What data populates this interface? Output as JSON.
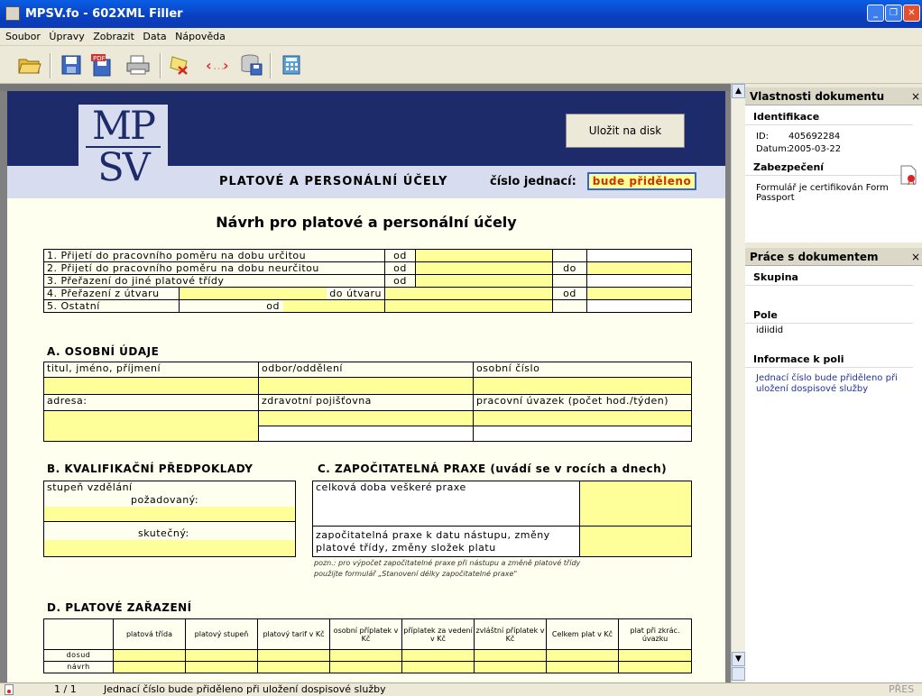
{
  "window": {
    "title": "MPSV.fo - 602XML Filler"
  },
  "menu": [
    "Soubor",
    "Úpravy",
    "Zobrazit",
    "Data",
    "Nápověda"
  ],
  "toolbar": {
    "icons": [
      "open-icon",
      "save-icon",
      "export-pdf-icon",
      "print-icon",
      "clear-form-icon",
      "xml-icon",
      "database-save-icon",
      "calculator-icon"
    ],
    "pdf_label": "PDF"
  },
  "form": {
    "logo_line1": "MP",
    "logo_line2": "SV",
    "save_button": "Uložit na disk",
    "banner_title": "PLATOVÉ A PERSONÁLNÍ ÚČELY",
    "cislo_label": "číslo jednací:",
    "cislo_value": "bude přiděleno",
    "title": "Návrh pro platové a personální účely",
    "rows": [
      {
        "label": "1. Přijetí do pracovního poměru na dobu určitou",
        "od": "od"
      },
      {
        "label": "2. Přijetí do pracovního poměru na dobu neurčitou",
        "od": "od",
        "do": "do"
      },
      {
        "label": "3. Přeřazení do jiné platové třídy",
        "od": "od"
      },
      {
        "label": "4. Přeřazení z útvaru",
        "do_utvaru": "do útvaru",
        "od": "od"
      },
      {
        "label": "5. Ostatní",
        "od": "od"
      }
    ],
    "secA": {
      "title": "A. OSOBNÍ ÚDAJE",
      "titul": "titul, jméno, příjmení",
      "odbor": "odbor/oddělení",
      "oscislo": "osobní číslo",
      "adresa": "adresa:",
      "pojistovna": "zdravotní pojišťovna",
      "uvazek": "pracovní úvazek (počet hod./týden)"
    },
    "secB": {
      "title": "B. KVALIFIKAČNÍ PŘEDPOKLADY",
      "stupen": "stupeň vzdělání",
      "pozadovany": "požadovaný:",
      "skutecny": "skutečný:"
    },
    "secC": {
      "title": "C. ZAPOČITATELNÁ PRAXE (uvádí se v rocích a dnech)",
      "celkova": "celková doba veškeré praxe",
      "zapocitatelna_1": "započitatelná praxe k datu nástupu, změny",
      "zapocitatelna_2": "platové třídy, změny složek platu",
      "pozn_1": "pozn.: pro výpočet započitatelné praxe při nástupu a změně platové třídy",
      "pozn_2": "použijte formulář „Stanovení délky započitatelné praxe\""
    },
    "secD": {
      "title": "D. PLATOVÉ ZAŘAZENÍ",
      "headers": [
        "platová třída",
        "platový stupeň",
        "platový tarif v Kč",
        "osobní příplatek v Kč",
        "příplatek za vedení v Kč",
        "zvláštní příplatek v Kč",
        "Celkem plat v Kč",
        "plat při zkrác. úvazku"
      ],
      "rows": [
        "dosud",
        "návrh"
      ]
    }
  },
  "panel": {
    "vlastnosti": "Vlastnosti dokumentu",
    "identifikace": "Identifikace",
    "id_label": "ID:",
    "id_value": "405692284",
    "datum_label": "Datum:",
    "datum_value": "2005-03-22",
    "zabezpeceni": "Zabezpečení",
    "certified": "Formulář je certifikován Form Passport",
    "prace": "Práce s dokumentem",
    "skupina": "Skupina",
    "pole": "Pole",
    "pole_value": "idiidid",
    "informace": "Informace k poli",
    "info_text": "Jednací číslo bude přiděleno při uložení dospisové služby",
    "close": "×"
  },
  "status": {
    "page": "1 / 1",
    "message": "Jednací číslo bude přiděleno při uložení dospisové služby",
    "mode": "PŘES"
  }
}
